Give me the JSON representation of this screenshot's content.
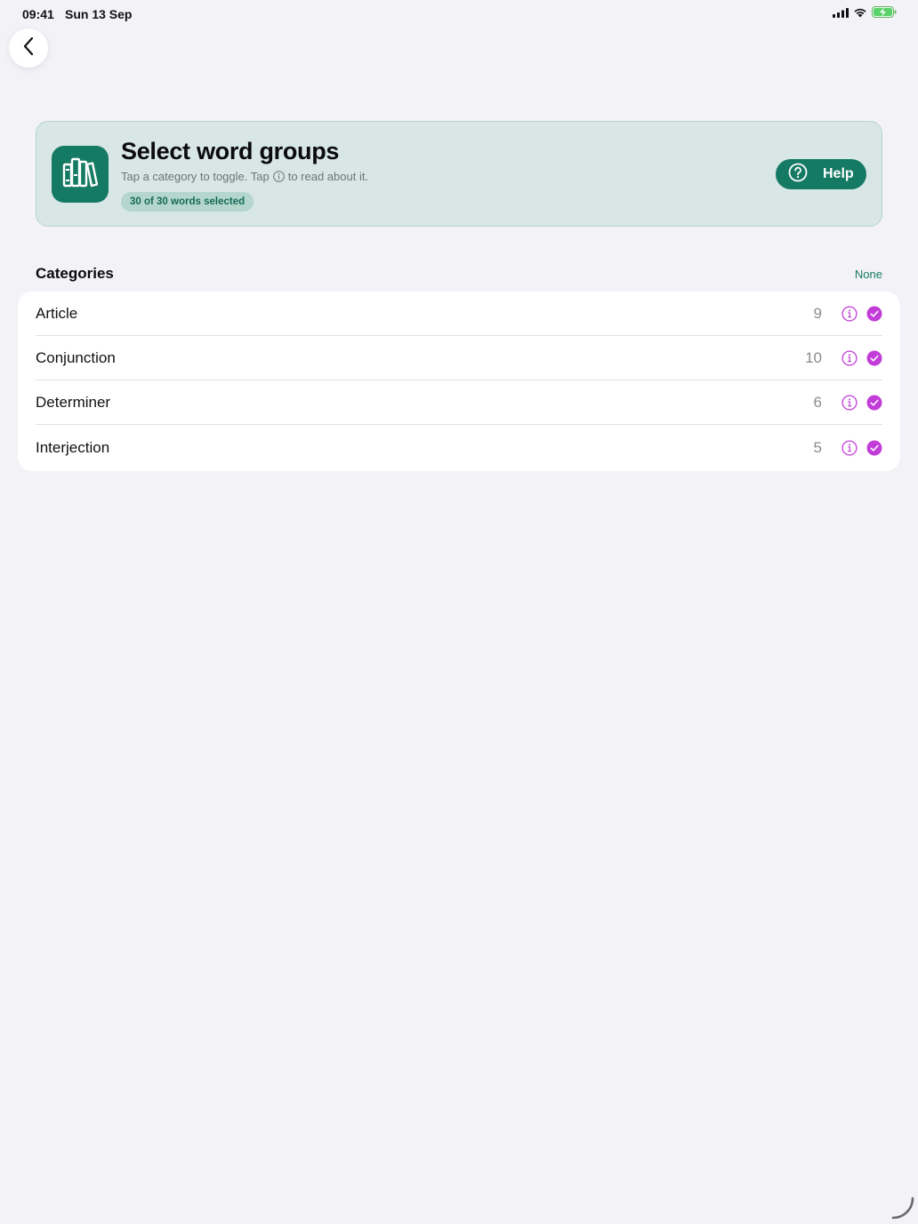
{
  "status_bar": {
    "time": "09:41",
    "date": "Sun 13 Sep"
  },
  "header": {
    "title": "Select word groups",
    "subtitle_before": "Tap a category to toggle. Tap",
    "subtitle_after": "to read about it.",
    "selected_badge": "30 of 30 words selected",
    "help_label": "Help"
  },
  "categories": {
    "section_title": "Categories",
    "none_label": "None",
    "rows": [
      {
        "label": "Article",
        "count": "9"
      },
      {
        "label": "Conjunction",
        "count": "10"
      },
      {
        "label": "Determiner",
        "count": "6"
      },
      {
        "label": "Interjection",
        "count": "5"
      }
    ]
  },
  "colors": {
    "accent": "#157a64",
    "check": "#c23dd8",
    "background": "#f2f2f7"
  }
}
